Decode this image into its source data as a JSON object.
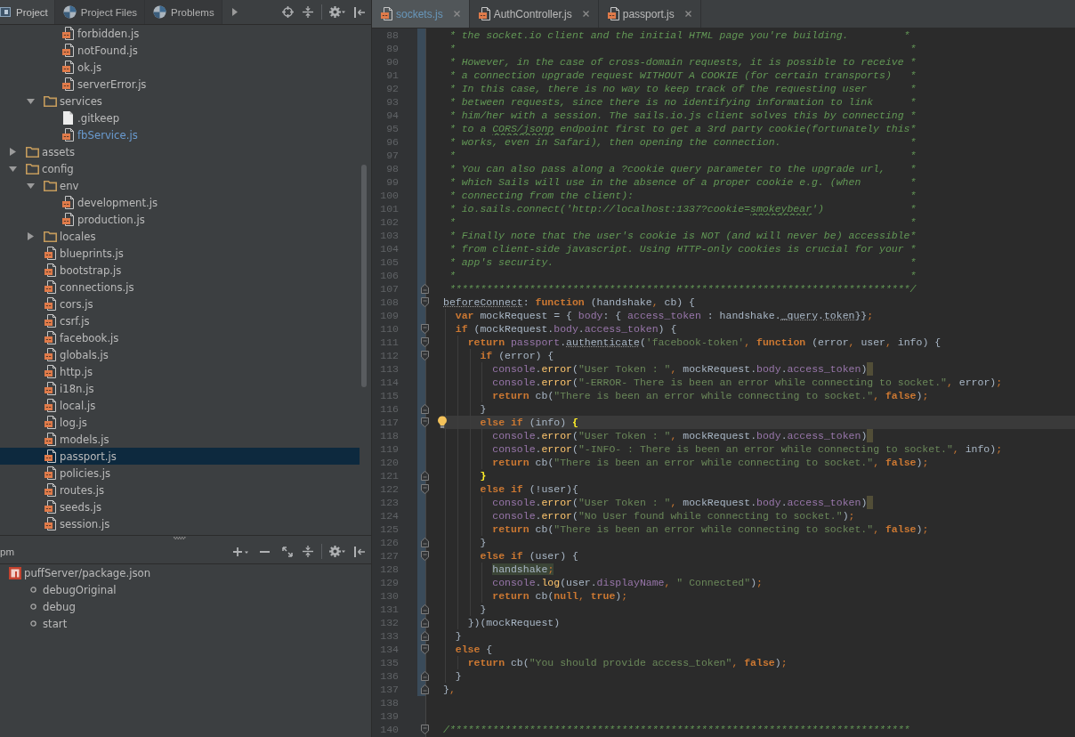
{
  "project_panel": {
    "tabs": [
      {
        "label": "Project",
        "selected": true
      },
      {
        "label": "Project Files",
        "selected": false
      },
      {
        "label": "Problems",
        "selected": false
      }
    ],
    "tree": [
      {
        "children": [
          {
            "children": [
              {
                "name": "forbidden.js",
                "kind": "js",
                "selected": false,
                "modified": false
              },
              {
                "name": "notFound.js",
                "kind": "js",
                "selected": false,
                "modified": false
              },
              {
                "name": "ok.js",
                "kind": "js",
                "selected": false,
                "modified": false
              },
              {
                "name": "serverError.js",
                "kind": "js",
                "selected": false,
                "modified": false
              }
            ]
          },
          {
            "name": "services",
            "kind": "folder",
            "expanded": true,
            "selected": false,
            "modified": false,
            "children": [
              {
                "name": ".gitkeep",
                "kind": "file",
                "selected": false,
                "modified": false
              },
              {
                "name": "fbService.js",
                "kind": "js",
                "selected": false,
                "modified": true
              }
            ]
          }
        ]
      },
      {
        "name": "assets",
        "kind": "folder",
        "expanded": false,
        "selected": false,
        "modified": false
      },
      {
        "name": "config",
        "kind": "folder",
        "expanded": true,
        "selected": false,
        "modified": false,
        "children": [
          {
            "name": "env",
            "kind": "folder",
            "expanded": true,
            "selected": false,
            "modified": false,
            "children": [
              {
                "name": "development.js",
                "kind": "js",
                "selected": false,
                "modified": false
              },
              {
                "name": "production.js",
                "kind": "js",
                "selected": false,
                "modified": false
              }
            ]
          },
          {
            "name": "locales",
            "kind": "folder",
            "expanded": false,
            "selected": false,
            "modified": false
          },
          {
            "name": "blueprints.js",
            "kind": "js",
            "selected": false,
            "modified": false
          },
          {
            "name": "bootstrap.js",
            "kind": "js",
            "selected": false,
            "modified": false
          },
          {
            "name": "connections.js",
            "kind": "js",
            "selected": false,
            "modified": false
          },
          {
            "name": "cors.js",
            "kind": "js",
            "selected": false,
            "modified": false
          },
          {
            "name": "csrf.js",
            "kind": "js",
            "selected": false,
            "modified": false
          },
          {
            "name": "facebook.js",
            "kind": "js",
            "selected": false,
            "modified": false
          },
          {
            "name": "globals.js",
            "kind": "js",
            "selected": false,
            "modified": false
          },
          {
            "name": "http.js",
            "kind": "js",
            "selected": false,
            "modified": false
          },
          {
            "name": "i18n.js",
            "kind": "js",
            "selected": false,
            "modified": false
          },
          {
            "name": "local.js",
            "kind": "js",
            "selected": false,
            "modified": false
          },
          {
            "name": "log.js",
            "kind": "js",
            "selected": false,
            "modified": false
          },
          {
            "name": "models.js",
            "kind": "js",
            "selected": false,
            "modified": false
          },
          {
            "name": "passport.js",
            "kind": "js",
            "selected": true,
            "modified": false
          },
          {
            "name": "policies.js",
            "kind": "js",
            "selected": false,
            "modified": false
          },
          {
            "name": "routes.js",
            "kind": "js",
            "selected": false,
            "modified": false
          },
          {
            "name": "seeds.js",
            "kind": "js",
            "selected": false,
            "modified": false
          },
          {
            "name": "session.js",
            "kind": "js",
            "selected": false,
            "modified": false
          }
        ]
      }
    ]
  },
  "npm_panel": {
    "title": "pm",
    "tree": [
      {
        "name": "puffServer/package.json",
        "children": [
          {
            "name": "debugOriginal"
          },
          {
            "name": "debug"
          },
          {
            "name": "start"
          }
        ]
      }
    ]
  },
  "editor": {
    "tabs": [
      {
        "label": "sockets.js",
        "selected": true,
        "modified": true
      },
      {
        "label": "AuthController.js",
        "selected": false,
        "modified": false
      },
      {
        "label": "passport.js",
        "selected": false,
        "modified": false
      }
    ],
    "lines": [
      {
        "number": "88",
        "changed": true,
        "current": false,
        "fold_open": false,
        "fold_close": false,
        "bulb": false,
        "warning": false,
        "tokens": [
          {
            "kind": "comment",
            "text": " * the socket.io client and the initial HTML page you're building.         *"
          }
        ]
      },
      {
        "number": "89",
        "changed": true,
        "current": false,
        "fold_open": false,
        "fold_close": false,
        "bulb": false,
        "warning": false,
        "tokens": [
          {
            "kind": "comment",
            "text": " *                                                                          *"
          }
        ]
      },
      {
        "number": "90",
        "changed": true,
        "current": false,
        "fold_open": false,
        "fold_close": false,
        "bulb": false,
        "warning": false,
        "tokens": [
          {
            "kind": "comment",
            "text": " * However, in the case of cross-domain requests, it is possible to receive *"
          }
        ]
      },
      {
        "number": "91",
        "changed": true,
        "current": false,
        "fold_open": false,
        "fold_close": false,
        "bulb": false,
        "warning": false,
        "tokens": [
          {
            "kind": "comment",
            "text": " * a connection upgrade request WITHOUT A COOKIE (for certain transports)   *"
          }
        ]
      },
      {
        "number": "92",
        "changed": true,
        "current": false,
        "fold_open": false,
        "fold_close": false,
        "bulb": false,
        "warning": false,
        "tokens": [
          {
            "kind": "comment",
            "text": " * In this case, there is no way to keep track of the requesting user       *"
          }
        ]
      },
      {
        "number": "93",
        "changed": true,
        "current": false,
        "fold_open": false,
        "fold_close": false,
        "bulb": false,
        "warning": false,
        "tokens": [
          {
            "kind": "comment",
            "text": " * between requests, since there is no identifying information to link      *"
          }
        ]
      },
      {
        "number": "94",
        "changed": true,
        "current": false,
        "fold_open": false,
        "fold_close": false,
        "bulb": false,
        "warning": false,
        "tokens": [
          {
            "kind": "comment",
            "text": " * him/her with a session. The sails.io.js client solves this by connecting *"
          }
        ]
      },
      {
        "number": "95",
        "changed": true,
        "current": false,
        "fold_open": false,
        "fold_close": false,
        "bulb": false,
        "warning": false,
        "tokens": [
          {
            "kind": "comment",
            "text": " * to a "
          },
          {
            "kind": "comment_typo",
            "text": "CORS/jsonp"
          },
          {
            "kind": "comment",
            "text": " endpoint first to get a 3rd party cookie(fortunately this*"
          }
        ]
      },
      {
        "number": "96",
        "changed": true,
        "current": false,
        "fold_open": false,
        "fold_close": false,
        "bulb": false,
        "warning": false,
        "tokens": [
          {
            "kind": "comment",
            "text": " * works, even in Safari), then opening the connection.                     *"
          }
        ]
      },
      {
        "number": "97",
        "changed": true,
        "current": false,
        "fold_open": false,
        "fold_close": false,
        "bulb": false,
        "warning": false,
        "tokens": [
          {
            "kind": "comment",
            "text": " *                                                                          *"
          }
        ]
      },
      {
        "number": "98",
        "changed": true,
        "current": false,
        "fold_open": false,
        "fold_close": false,
        "bulb": false,
        "warning": false,
        "tokens": [
          {
            "kind": "comment",
            "text": " * You can also pass along a ?cookie query parameter to the upgrade url,    *"
          }
        ]
      },
      {
        "number": "99",
        "changed": true,
        "current": false,
        "fold_open": false,
        "fold_close": false,
        "bulb": false,
        "warning": false,
        "tokens": [
          {
            "kind": "comment",
            "text": " * which Sails will use in the absence of a proper cookie e.g. (when        *"
          }
        ]
      },
      {
        "number": "100",
        "changed": true,
        "current": false,
        "fold_open": false,
        "fold_close": false,
        "bulb": false,
        "warning": false,
        "tokens": [
          {
            "kind": "comment",
            "text": " * connecting from the client):                                             *"
          }
        ]
      },
      {
        "number": "101",
        "changed": true,
        "current": false,
        "fold_open": false,
        "fold_close": false,
        "bulb": false,
        "warning": false,
        "tokens": [
          {
            "kind": "comment",
            "text": " * io.sails.connect('http://localhost:1337?cookie="
          },
          {
            "kind": "comment_typo",
            "text": "smokeybear"
          },
          {
            "kind": "comment",
            "text": "')              *"
          }
        ]
      },
      {
        "number": "102",
        "changed": true,
        "current": false,
        "fold_open": false,
        "fold_close": false,
        "bulb": false,
        "warning": false,
        "tokens": [
          {
            "kind": "comment",
            "text": " *                                                                          *"
          }
        ]
      },
      {
        "number": "103",
        "changed": true,
        "current": false,
        "fold_open": false,
        "fold_close": false,
        "bulb": false,
        "warning": false,
        "tokens": [
          {
            "kind": "comment",
            "text": " * Finally note that the user's cookie is NOT (and will never be) accessible*"
          }
        ]
      },
      {
        "number": "104",
        "changed": true,
        "current": false,
        "fold_open": false,
        "fold_close": false,
        "bulb": false,
        "warning": false,
        "tokens": [
          {
            "kind": "comment",
            "text": " * from client-side javascript. Using HTTP-only cookies is crucial for your *"
          }
        ]
      },
      {
        "number": "105",
        "changed": true,
        "current": false,
        "fold_open": false,
        "fold_close": false,
        "bulb": false,
        "warning": false,
        "tokens": [
          {
            "kind": "comment",
            "text": " * app's security.                                                          *"
          }
        ]
      },
      {
        "number": "106",
        "changed": true,
        "current": false,
        "fold_open": false,
        "fold_close": false,
        "bulb": false,
        "warning": false,
        "tokens": [
          {
            "kind": "comment",
            "text": " *                                                                          *"
          }
        ]
      },
      {
        "number": "107",
        "changed": true,
        "current": false,
        "fold_open": false,
        "fold_close": true,
        "bulb": false,
        "warning": false,
        "tokens": [
          {
            "kind": "comment",
            "text": " ***************************************************************************/"
          }
        ]
      },
      {
        "number": "108",
        "changed": true,
        "current": false,
        "fold_open": true,
        "fold_close": false,
        "bulb": false,
        "warning": false,
        "tokens": [
          {
            "kind": "plain_warn",
            "text": "beforeConnect"
          },
          {
            "kind": "plain",
            "text": ": "
          },
          {
            "kind": "keyword",
            "text": "function"
          },
          {
            "kind": "plain",
            "text": " (handshake"
          },
          {
            "kind": "punct",
            "text": ","
          },
          {
            "kind": "plain",
            "text": " cb) {"
          }
        ]
      },
      {
        "number": "109",
        "changed": true,
        "current": false,
        "fold_open": false,
        "fold_close": false,
        "bulb": false,
        "warning": false,
        "tokens": [
          {
            "kind": "keyword",
            "text": "  var"
          },
          {
            "kind": "plain",
            "text": " mockRequest = { "
          },
          {
            "kind": "property",
            "text": "body"
          },
          {
            "kind": "plain",
            "text": ": { "
          },
          {
            "kind": "property",
            "text": "access_token"
          },
          {
            "kind": "plain",
            "text": " : handshake."
          },
          {
            "kind": "plain_warn",
            "text": "_query"
          },
          {
            "kind": "plain",
            "text": "."
          },
          {
            "kind": "plain_warn",
            "text": "token"
          },
          {
            "kind": "plain",
            "text": "}}"
          },
          {
            "kind": "punct",
            "text": ";"
          }
        ]
      },
      {
        "number": "110",
        "changed": true,
        "current": false,
        "fold_open": true,
        "fold_close": false,
        "bulb": false,
        "warning": false,
        "tokens": [
          {
            "kind": "keyword",
            "text": "  if"
          },
          {
            "kind": "plain",
            "text": " (mockRequest."
          },
          {
            "kind": "property",
            "text": "body"
          },
          {
            "kind": "plain",
            "text": "."
          },
          {
            "kind": "property",
            "text": "access_token"
          },
          {
            "kind": "plain",
            "text": ") {"
          }
        ]
      },
      {
        "number": "111",
        "changed": true,
        "current": false,
        "fold_open": true,
        "fold_close": false,
        "bulb": false,
        "warning": false,
        "tokens": [
          {
            "kind": "keyword",
            "text": "    return"
          },
          {
            "kind": "property",
            "text": " passport"
          },
          {
            "kind": "plain",
            "text": "."
          },
          {
            "kind": "plain_warn",
            "text": "authenticate"
          },
          {
            "kind": "plain",
            "text": "("
          },
          {
            "kind": "string",
            "text": "'facebook-token'"
          },
          {
            "kind": "punct",
            "text": ","
          },
          {
            "kind": "keyword",
            "text": " function"
          },
          {
            "kind": "plain",
            "text": " (error"
          },
          {
            "kind": "punct",
            "text": ","
          },
          {
            "kind": "plain",
            "text": " user"
          },
          {
            "kind": "punct",
            "text": ","
          },
          {
            "kind": "plain",
            "text": " info) {"
          }
        ]
      },
      {
        "number": "112",
        "changed": true,
        "current": false,
        "fold_open": true,
        "fold_close": false,
        "bulb": false,
        "warning": false,
        "tokens": [
          {
            "kind": "keyword",
            "text": "      if"
          },
          {
            "kind": "plain",
            "text": " (error) {"
          }
        ]
      },
      {
        "number": "113",
        "changed": true,
        "current": false,
        "fold_open": false,
        "fold_close": false,
        "bulb": false,
        "warning": true,
        "tokens": [
          {
            "kind": "property",
            "text": "        console"
          },
          {
            "kind": "plain",
            "text": "."
          },
          {
            "kind": "call",
            "text": "error"
          },
          {
            "kind": "plain",
            "text": "("
          },
          {
            "kind": "string",
            "text": "\"User Token : \""
          },
          {
            "kind": "punct",
            "text": ","
          },
          {
            "kind": "plain",
            "text": " mockRequest."
          },
          {
            "kind": "property",
            "text": "body"
          },
          {
            "kind": "plain",
            "text": "."
          },
          {
            "kind": "property",
            "text": "access_token"
          },
          {
            "kind": "plain",
            "text": ")"
          }
        ]
      },
      {
        "number": "114",
        "changed": true,
        "current": false,
        "fold_open": false,
        "fold_close": false,
        "bulb": false,
        "warning": false,
        "tokens": [
          {
            "kind": "property",
            "text": "        console"
          },
          {
            "kind": "plain",
            "text": "."
          },
          {
            "kind": "call",
            "text": "error"
          },
          {
            "kind": "plain",
            "text": "("
          },
          {
            "kind": "string",
            "text": "\"-ERROR- There is been an error while connecting to socket.\""
          },
          {
            "kind": "punct",
            "text": ","
          },
          {
            "kind": "plain",
            "text": " error)"
          },
          {
            "kind": "punct",
            "text": ";"
          }
        ]
      },
      {
        "number": "115",
        "changed": true,
        "current": false,
        "fold_open": false,
        "fold_close": false,
        "bulb": false,
        "warning": false,
        "tokens": [
          {
            "kind": "keyword",
            "text": "        return"
          },
          {
            "kind": "plain",
            "text": " cb("
          },
          {
            "kind": "string",
            "text": "\"There is been an error while connecting to socket.\""
          },
          {
            "kind": "punct",
            "text": ","
          },
          {
            "kind": "keyword",
            "text": " false"
          },
          {
            "kind": "plain",
            "text": ")"
          },
          {
            "kind": "punct",
            "text": ";"
          }
        ]
      },
      {
        "number": "116",
        "changed": true,
        "current": false,
        "fold_open": false,
        "fold_close": true,
        "bulb": false,
        "warning": false,
        "tokens": [
          {
            "kind": "plain",
            "text": "      }"
          }
        ]
      },
      {
        "number": "117",
        "changed": true,
        "current": true,
        "fold_open": true,
        "fold_close": false,
        "bulb": true,
        "warning": false,
        "tokens": [
          {
            "kind": "keyword",
            "text": "      else if"
          },
          {
            "kind": "plain",
            "text": " (info) "
          },
          {
            "kind": "brace_match",
            "text": "{"
          }
        ]
      },
      {
        "number": "118",
        "changed": true,
        "current": false,
        "fold_open": false,
        "fold_close": false,
        "bulb": false,
        "warning": true,
        "tokens": [
          {
            "kind": "property",
            "text": "        console"
          },
          {
            "kind": "plain",
            "text": "."
          },
          {
            "kind": "call",
            "text": "error"
          },
          {
            "kind": "plain",
            "text": "("
          },
          {
            "kind": "string",
            "text": "\"User Token : \""
          },
          {
            "kind": "punct",
            "text": ","
          },
          {
            "kind": "plain",
            "text": " mockRequest."
          },
          {
            "kind": "property",
            "text": "body"
          },
          {
            "kind": "plain",
            "text": "."
          },
          {
            "kind": "property",
            "text": "access_token"
          },
          {
            "kind": "plain",
            "text": ")"
          }
        ]
      },
      {
        "number": "119",
        "changed": true,
        "current": false,
        "fold_open": false,
        "fold_close": false,
        "bulb": false,
        "warning": false,
        "tokens": [
          {
            "kind": "property",
            "text": "        console"
          },
          {
            "kind": "plain",
            "text": "."
          },
          {
            "kind": "call",
            "text": "error"
          },
          {
            "kind": "plain",
            "text": "("
          },
          {
            "kind": "string",
            "text": "\"-INFO- : There is been an error while connecting to socket.\""
          },
          {
            "kind": "punct",
            "text": ","
          },
          {
            "kind": "plain",
            "text": " info)"
          },
          {
            "kind": "punct",
            "text": ";"
          }
        ]
      },
      {
        "number": "120",
        "changed": true,
        "current": false,
        "fold_open": false,
        "fold_close": false,
        "bulb": false,
        "warning": false,
        "tokens": [
          {
            "kind": "keyword",
            "text": "        return"
          },
          {
            "kind": "plain",
            "text": " cb("
          },
          {
            "kind": "string",
            "text": "\"There is been an error while connecting to socket.\""
          },
          {
            "kind": "punct",
            "text": ","
          },
          {
            "kind": "keyword",
            "text": " false"
          },
          {
            "kind": "plain",
            "text": ")"
          },
          {
            "kind": "punct",
            "text": ";"
          }
        ]
      },
      {
        "number": "121",
        "changed": true,
        "current": false,
        "fold_open": false,
        "fold_close": true,
        "bulb": false,
        "warning": false,
        "tokens": [
          {
            "kind": "brace_match",
            "text": "      }"
          }
        ]
      },
      {
        "number": "122",
        "changed": true,
        "current": false,
        "fold_open": true,
        "fold_close": false,
        "bulb": false,
        "warning": false,
        "tokens": [
          {
            "kind": "keyword",
            "text": "      else if"
          },
          {
            "kind": "plain",
            "text": " (!user){"
          }
        ]
      },
      {
        "number": "123",
        "changed": true,
        "current": false,
        "fold_open": false,
        "fold_close": false,
        "bulb": false,
        "warning": true,
        "tokens": [
          {
            "kind": "property",
            "text": "        console"
          },
          {
            "kind": "plain",
            "text": "."
          },
          {
            "kind": "call",
            "text": "error"
          },
          {
            "kind": "plain",
            "text": "("
          },
          {
            "kind": "string",
            "text": "\"User Token : \""
          },
          {
            "kind": "punct",
            "text": ","
          },
          {
            "kind": "plain",
            "text": " mockRequest."
          },
          {
            "kind": "property",
            "text": "body"
          },
          {
            "kind": "plain",
            "text": "."
          },
          {
            "kind": "property",
            "text": "access_token"
          },
          {
            "kind": "plain",
            "text": ")"
          }
        ]
      },
      {
        "number": "124",
        "changed": true,
        "current": false,
        "fold_open": false,
        "fold_close": false,
        "bulb": false,
        "warning": false,
        "tokens": [
          {
            "kind": "property",
            "text": "        console"
          },
          {
            "kind": "plain",
            "text": "."
          },
          {
            "kind": "call",
            "text": "error"
          },
          {
            "kind": "plain",
            "text": "("
          },
          {
            "kind": "string",
            "text": "\"No User found while connecting to socket.\""
          },
          {
            "kind": "plain",
            "text": ")"
          },
          {
            "kind": "punct",
            "text": ";"
          }
        ]
      },
      {
        "number": "125",
        "changed": true,
        "current": false,
        "fold_open": false,
        "fold_close": false,
        "bulb": false,
        "warning": false,
        "tokens": [
          {
            "kind": "keyword",
            "text": "        return"
          },
          {
            "kind": "plain",
            "text": " cb("
          },
          {
            "kind": "string",
            "text": "\"There is been an error while connecting to socket.\""
          },
          {
            "kind": "punct",
            "text": ","
          },
          {
            "kind": "keyword",
            "text": " false"
          },
          {
            "kind": "plain",
            "text": ")"
          },
          {
            "kind": "punct",
            "text": ";"
          }
        ]
      },
      {
        "number": "126",
        "changed": true,
        "current": false,
        "fold_open": false,
        "fold_close": true,
        "bulb": false,
        "warning": false,
        "tokens": [
          {
            "kind": "plain",
            "text": "      }"
          }
        ]
      },
      {
        "number": "127",
        "changed": true,
        "current": false,
        "fold_open": true,
        "fold_close": false,
        "bulb": false,
        "warning": false,
        "tokens": [
          {
            "kind": "keyword",
            "text": "      else if"
          },
          {
            "kind": "plain",
            "text": " (user) {"
          }
        ]
      },
      {
        "number": "128",
        "changed": true,
        "current": false,
        "fold_open": false,
        "fold_close": false,
        "bulb": false,
        "warning": false,
        "tokens": [
          {
            "kind": "highlight",
            "text": "        handshake"
          },
          {
            "kind": "highlight_punct",
            "text": ";"
          }
        ]
      },
      {
        "number": "129",
        "changed": true,
        "current": false,
        "fold_open": false,
        "fold_close": false,
        "bulb": false,
        "warning": false,
        "tokens": [
          {
            "kind": "property",
            "text": "        console"
          },
          {
            "kind": "plain",
            "text": "."
          },
          {
            "kind": "call",
            "text": "log"
          },
          {
            "kind": "plain",
            "text": "(user."
          },
          {
            "kind": "property",
            "text": "displayName"
          },
          {
            "kind": "punct",
            "text": ","
          },
          {
            "kind": "string",
            "text": " \" Connected\""
          },
          {
            "kind": "plain",
            "text": ")"
          },
          {
            "kind": "punct",
            "text": ";"
          }
        ]
      },
      {
        "number": "130",
        "changed": true,
        "current": false,
        "fold_open": false,
        "fold_close": false,
        "bulb": false,
        "warning": false,
        "tokens": [
          {
            "kind": "keyword",
            "text": "        return"
          },
          {
            "kind": "plain",
            "text": " cb("
          },
          {
            "kind": "keyword",
            "text": "null"
          },
          {
            "kind": "punct",
            "text": ","
          },
          {
            "kind": "keyword",
            "text": " true"
          },
          {
            "kind": "plain",
            "text": ")"
          },
          {
            "kind": "punct",
            "text": ";"
          }
        ]
      },
      {
        "number": "131",
        "changed": true,
        "current": false,
        "fold_open": false,
        "fold_close": true,
        "bulb": false,
        "warning": false,
        "tokens": [
          {
            "kind": "plain",
            "text": "      }"
          }
        ]
      },
      {
        "number": "132",
        "changed": true,
        "current": false,
        "fold_open": false,
        "fold_close": true,
        "bulb": false,
        "warning": false,
        "tokens": [
          {
            "kind": "plain",
            "text": "    })(mockRequest)"
          }
        ]
      },
      {
        "number": "133",
        "changed": true,
        "current": false,
        "fold_open": false,
        "fold_close": true,
        "bulb": false,
        "warning": false,
        "tokens": [
          {
            "kind": "plain",
            "text": "  }"
          }
        ]
      },
      {
        "number": "134",
        "changed": true,
        "current": false,
        "fold_open": true,
        "fold_close": false,
        "bulb": false,
        "warning": false,
        "tokens": [
          {
            "kind": "keyword",
            "text": "  else"
          },
          {
            "kind": "plain",
            "text": " {"
          }
        ]
      },
      {
        "number": "135",
        "changed": true,
        "current": false,
        "fold_open": false,
        "fold_close": false,
        "bulb": false,
        "warning": false,
        "tokens": [
          {
            "kind": "keyword",
            "text": "    return"
          },
          {
            "kind": "plain",
            "text": " cb("
          },
          {
            "kind": "string",
            "text": "\"You should provide access_token\""
          },
          {
            "kind": "punct",
            "text": ","
          },
          {
            "kind": "keyword",
            "text": " false"
          },
          {
            "kind": "plain",
            "text": ")"
          },
          {
            "kind": "punct",
            "text": ";"
          }
        ]
      },
      {
        "number": "136",
        "changed": true,
        "current": false,
        "fold_open": false,
        "fold_close": true,
        "bulb": false,
        "warning": false,
        "tokens": [
          {
            "kind": "plain",
            "text": "  }"
          }
        ]
      },
      {
        "number": "137",
        "changed": true,
        "current": false,
        "fold_open": false,
        "fold_close": true,
        "bulb": false,
        "warning": false,
        "tokens": [
          {
            "kind": "plain",
            "text": "}"
          },
          {
            "kind": "punct",
            "text": ","
          }
        ]
      },
      {
        "number": "138",
        "changed": false,
        "current": false,
        "fold_open": false,
        "fold_close": false,
        "bulb": false,
        "warning": false
      },
      {
        "number": "139",
        "changed": false,
        "current": false,
        "fold_open": false,
        "fold_close": false,
        "bulb": false,
        "warning": false
      },
      {
        "number": "140",
        "changed": false,
        "current": false,
        "fold_open": true,
        "fold_close": false,
        "bulb": false,
        "warning": false,
        "tokens": [
          {
            "kind": "comment",
            "text": "/***************************************************************************"
          }
        ]
      }
    ]
  }
}
